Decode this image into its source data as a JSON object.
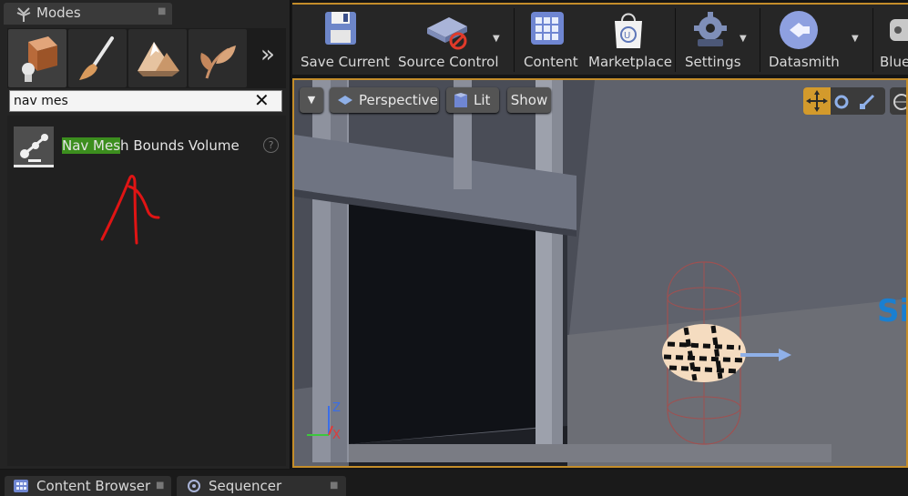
{
  "modes_panel": {
    "tab_label": "Modes",
    "mode_buttons": [
      "place-mode",
      "paint-mode",
      "landscape-mode",
      "foliage-mode"
    ],
    "search": {
      "value": "nav mes",
      "clear_symbol": "✕"
    },
    "result": {
      "label_highlight": "Nav Mes",
      "label_rest": "h Bounds Volume",
      "help_symbol": "?"
    },
    "more_symbol": "»"
  },
  "toolbar": {
    "buttons": [
      {
        "label": "Save Current",
        "icon": "floppy-disk-icon"
      },
      {
        "label": "Source Control",
        "icon": "source-control-icon"
      },
      {
        "label": "Content",
        "icon": "content-grid-icon"
      },
      {
        "label": "Marketplace",
        "icon": "marketplace-bag-icon"
      },
      {
        "label": "Settings",
        "icon": "gear-icon"
      },
      {
        "label": "Datasmith",
        "icon": "datasmith-icon"
      },
      {
        "label": "Blue",
        "icon": "blueprint-icon"
      }
    ]
  },
  "viewport": {
    "perspective_label": "Perspective",
    "lit_label": "Lit",
    "show_label": "Show",
    "axis_z": "Z",
    "axis_x": "X",
    "partial_text": "Si"
  },
  "bottom_tabs": [
    {
      "label": "Content Browser",
      "icon": "content-browser-icon"
    },
    {
      "label": "Sequencer",
      "icon": "sequencer-icon"
    }
  ],
  "colors": {
    "accent_orange": "#c48d2a",
    "highlight_green": "#3c8e1e",
    "annotation_red": "#e01414"
  }
}
